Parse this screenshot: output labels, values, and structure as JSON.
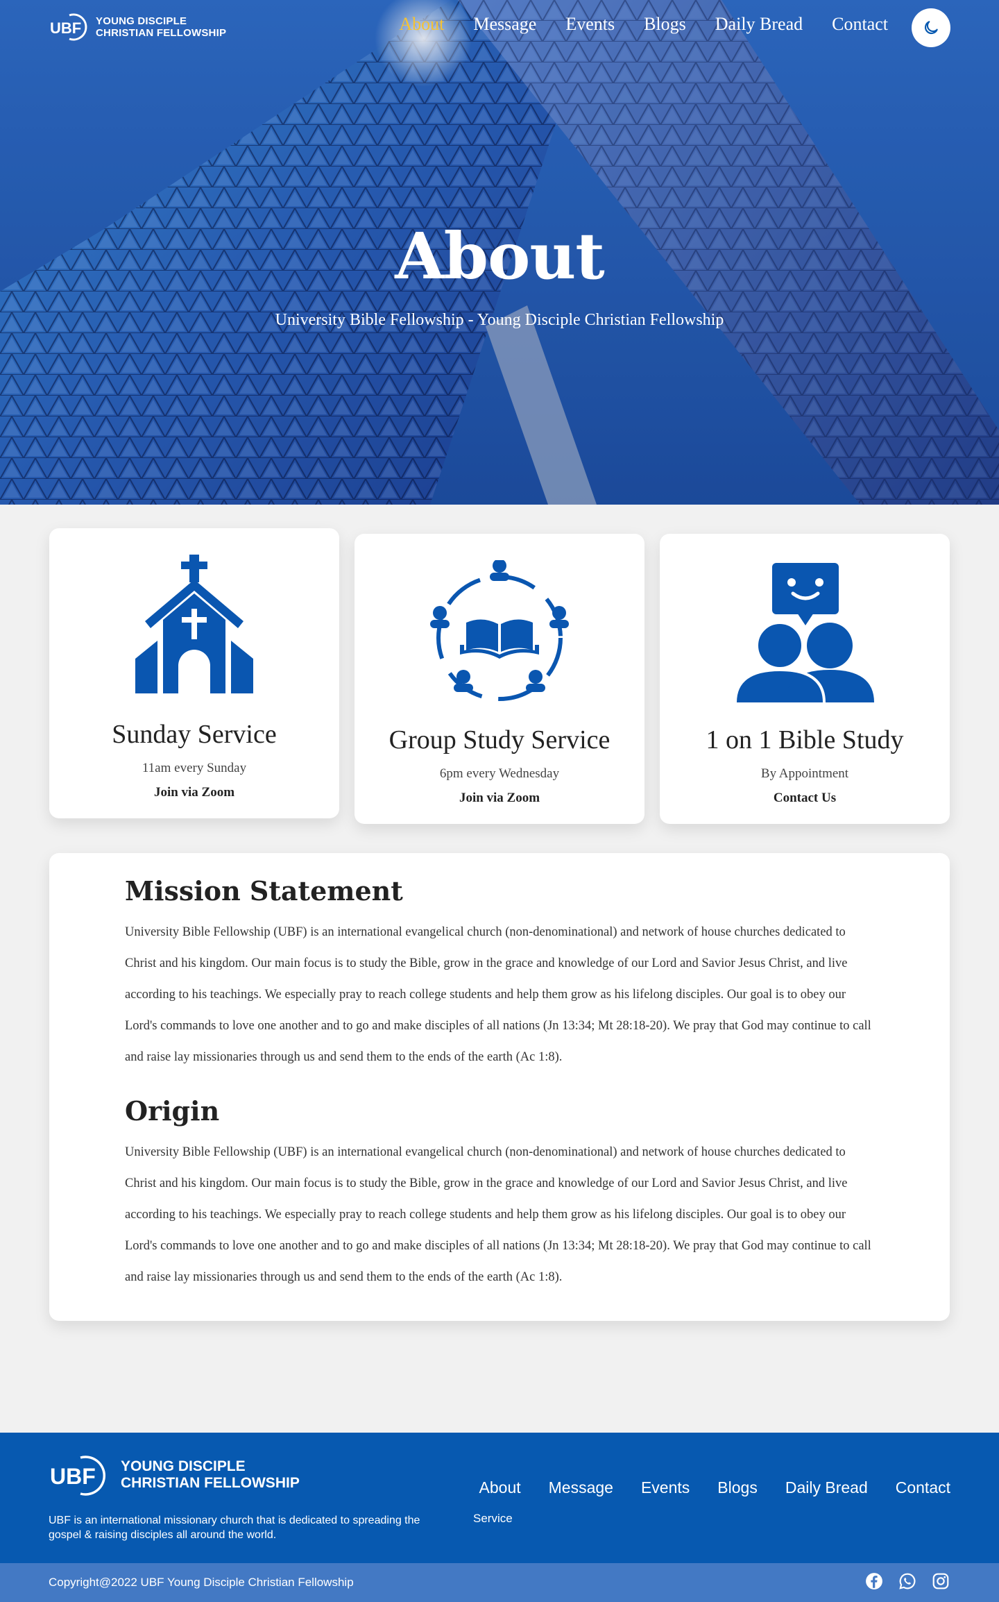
{
  "brand": {
    "logo_text": "UBF",
    "line1": "YOUNG DISCIPLE",
    "line2": "CHRISTIAN FELLOWSHIP"
  },
  "nav": {
    "items": [
      {
        "label": "About",
        "active": true
      },
      {
        "label": "Message"
      },
      {
        "label": "Events"
      },
      {
        "label": "Blogs"
      },
      {
        "label": "Daily Bread"
      },
      {
        "label": "Contact"
      }
    ],
    "theme_toggle_icon": "moon-icon"
  },
  "hero": {
    "title": "About",
    "subtitle": "University Bible Fellowship - Young Disciple Christian Fellowship"
  },
  "services": [
    {
      "icon": "church-icon",
      "title": "Sunday Service",
      "time": "11am every Sunday",
      "link": "Join via Zoom"
    },
    {
      "icon": "group-study-icon",
      "title": "Group Study Service",
      "time": "6pm every Wednesday",
      "link": "Join via Zoom"
    },
    {
      "icon": "one-on-one-icon",
      "title": "1 on 1 Bible Study",
      "time": "By Appointment",
      "link": "Contact Us"
    }
  ],
  "mission": {
    "title": "Mission Statement",
    "body": "University Bible Fellowship (UBF) is an international evangelical church (non-denominational) and network of house churches dedicated to Christ and his kingdom. Our main focus is to study the Bible, grow in the grace and knowledge of our Lord and Savior Jesus Christ, and live according to his teachings. We especially pray to reach college students and help them grow as his lifelong disciples. Our goal is to obey our Lord's commands to love one another and to go and make disciples of all nations (Jn 13:34; Mt 28:18-20). We pray that God may continue to call and raise lay missionaries through us and send them to the ends of the earth (Ac 1:8)."
  },
  "origin": {
    "title": "Origin",
    "body": "University Bible Fellowship (UBF) is an international evangelical church (non-denominational) and network of house churches dedicated to Christ and his kingdom. Our main focus is to study the Bible, grow in the grace and knowledge of our Lord and Savior Jesus Christ, and live according to his teachings. We especially pray to reach college students and help them grow as his lifelong disciples. Our goal is to obey our Lord's commands to love one another and to go and make disciples of all nations (Jn 13:34; Mt 28:18-20). We pray that God may continue to call and raise lay missionaries through us and send them to the ends of the earth (Ac 1:8)."
  },
  "footer": {
    "tagline": "UBF is an international missionary church that is dedicated to spreading the gospel & raising disciples all around the world.",
    "links": [
      "About",
      "Message",
      "Events",
      "Blogs",
      "Daily Bread",
      "Contact"
    ],
    "sub_link": "Service",
    "copyright": "Copyright@2022 UBF Young Disciple Christian Fellowship",
    "socials": [
      "facebook-icon",
      "whatsapp-icon",
      "instagram-icon"
    ]
  },
  "colors": {
    "primary": "#0759b0",
    "accent": "#f5c233",
    "icon_blue": "#0a56b0",
    "bottom_bar": "#4379c4",
    "page_bg": "#f1f1f1"
  }
}
